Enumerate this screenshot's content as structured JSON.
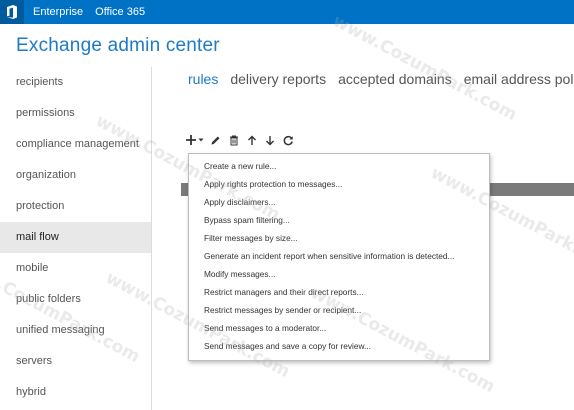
{
  "topbar": {
    "logo_icon": "office-logo-icon",
    "links": [
      "Enterprise",
      "Office 365"
    ]
  },
  "header": {
    "title": "Exchange admin center"
  },
  "sidebar": {
    "items": [
      {
        "label": "recipients"
      },
      {
        "label": "permissions"
      },
      {
        "label": "compliance management"
      },
      {
        "label": "organization"
      },
      {
        "label": "protection"
      },
      {
        "label": "mail flow",
        "active": true
      },
      {
        "label": "mobile"
      },
      {
        "label": "public folders"
      },
      {
        "label": "unified messaging"
      },
      {
        "label": "servers"
      },
      {
        "label": "hybrid"
      }
    ]
  },
  "tabs": [
    {
      "label": "rules",
      "active": true
    },
    {
      "label": "delivery reports"
    },
    {
      "label": "accepted domains"
    },
    {
      "label": "email address policies"
    }
  ],
  "toolbar": {
    "icons": [
      "add-icon",
      "dropdown-caret-icon",
      "edit-icon",
      "delete-icon",
      "move-up-icon",
      "move-down-icon",
      "refresh-icon"
    ]
  },
  "new_rule_menu": {
    "items": [
      "Create a new rule...",
      "Apply rights protection to messages...",
      "Apply disclaimers...",
      "Bypass spam filtering...",
      "Filter messages by size...",
      "Generate an incident report when sensitive information is detected...",
      "Modify messages...",
      "Restrict managers and their direct reports...",
      "Restrict messages by sender or recipient...",
      "Send messages to a moderator...",
      "Send messages and save a copy for review..."
    ]
  },
  "watermark": {
    "text": "www.CozumPark.com"
  },
  "colors": {
    "topbar": "#0072c6",
    "accent": "#1d7ac7",
    "active_nav_bg": "#e8e8e8",
    "selected_row": "#7a7a7a"
  }
}
